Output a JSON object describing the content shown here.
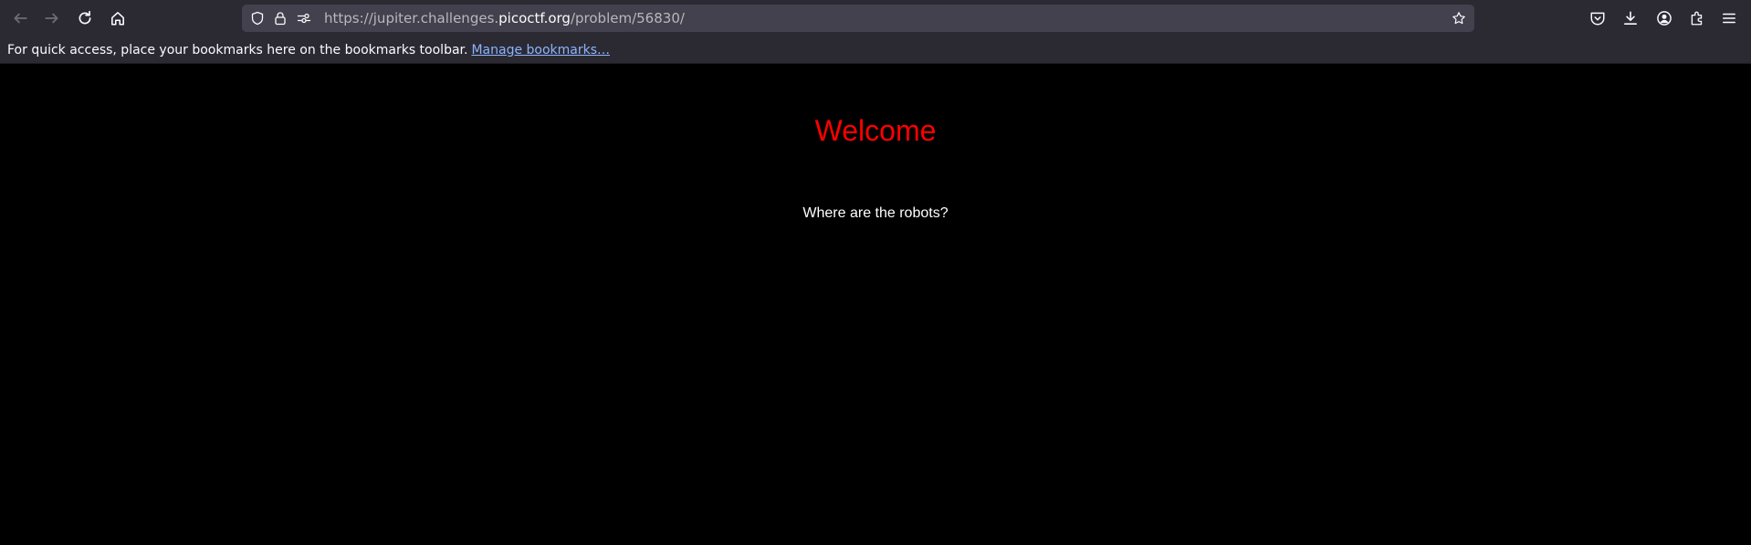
{
  "browser": {
    "url_prefix": "https://jupiter.challenges.",
    "url_domain": "picoctf.org",
    "url_path": "/problem/56830/",
    "icons": [
      "back-icon",
      "forward-icon",
      "reload-icon",
      "home-icon",
      "shield-icon",
      "lock-icon",
      "permissions-icon",
      "star-icon",
      "pocket-icon",
      "download-icon",
      "account-icon",
      "extensions-icon",
      "menu-icon"
    ]
  },
  "bookmarks": {
    "message": "For quick access, place your bookmarks here on the bookmarks toolbar.",
    "manage_link": "Manage bookmarks…"
  },
  "page": {
    "heading": "Welcome",
    "text": "Where are the robots?"
  },
  "colors": {
    "heading": "#ff0000",
    "background": "#000000",
    "chrome": "#2b2a33"
  }
}
